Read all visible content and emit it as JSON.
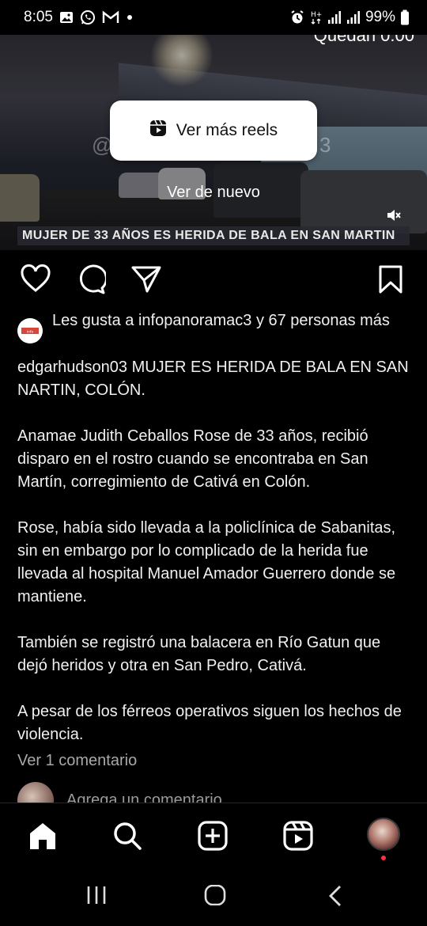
{
  "status_bar": {
    "time": "8:05",
    "left_icons": [
      "gallery-icon",
      "whatsapp-icon",
      "gmail-icon",
      "dot-icon"
    ],
    "right_icons": [
      "alarm-icon",
      "hd-icon",
      "signal-icon",
      "signal-icon",
      "battery-icon"
    ],
    "battery": "99%"
  },
  "video": {
    "remaining_label": "Quedan 0:00",
    "more_reels_label": "Ver más reels",
    "replay_label": "Ver de nuevo",
    "headline_text": "MUJER DE 33 AÑOS ES HERIDA DE BALA EN SAN MARTIN",
    "watermark": "@",
    "watermark_tail": "3"
  },
  "actions": {
    "icons": [
      "heart-icon",
      "comment-icon",
      "share-icon",
      "bookmark-icon"
    ]
  },
  "likes": {
    "text": "Les gusta a infopanoramac3 y 67 personas más",
    "avatar_label": "infopanorama"
  },
  "caption": {
    "username": "edgarhudson03",
    "text": " MUJER ES HERIDA DE BALA EN SAN NARTIN, COLÓN.\n\nAnamae Judith Ceballos Rose de 33 años, recibió disparo en el rostro cuando se encontraba en San Martín, corregimiento de Cativá en Colón.\n\nRose, había sido llevada a la policlínica de Sabanitas, sin en embargo por lo complicado de la herida fue llevada al hospital Manuel Amador Guerrero donde se mantiene.\n\nTambién se registró una balacera en Río Gatun que dejó heridos y otra en San Pedro, Cativá.\n\nA pesar de los férreos operativos siguen los hechos de violencia."
  },
  "comments": {
    "view_label": "Ver 1 comentario",
    "add_placeholder": "Agrega un comentario..."
  },
  "bottom_nav": [
    "home-icon",
    "search-icon",
    "create-icon",
    "reels-icon",
    "profile-avatar"
  ],
  "system_nav": [
    "recents-icon",
    "home-button-icon",
    "back-icon"
  ]
}
